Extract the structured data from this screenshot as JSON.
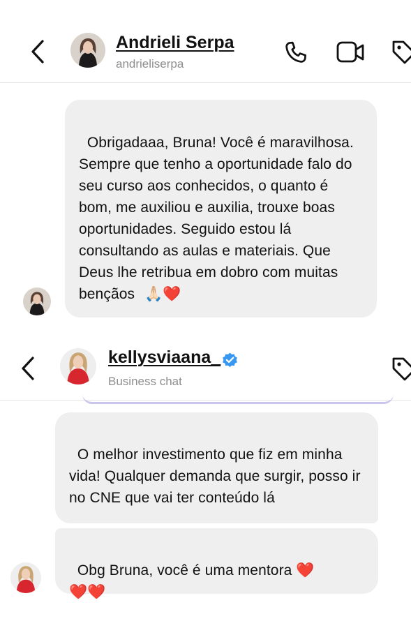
{
  "chat1": {
    "contact_name": "Andrieli Serpa",
    "username": "andrieliserpa",
    "message": "Obrigadaaa, Bruna! Você é maravilhosa. Sempre que tenho a oportunidade falo do seu curso aos conhecidos, o quanto é bom, me auxiliou e auxilia, trouxe boas oportunidades. Seguido estou lá consultando as aulas e materiais. Que Deus lhe retribua em dobro com muitas bençãos",
    "emoji": "🙏🏻❤️"
  },
  "chat2": {
    "contact_name": "kellysviaana_",
    "subtitle": "Business chat",
    "message1": "O melhor investimento que fiz em minha vida! Qualquer demanda que surgir, posso ir no CNE que vai ter conteúdo lá",
    "message2": "Obg Bruna, você é uma mentora",
    "emoji2_inline": "❤️",
    "emoji2_line": "❤️❤️"
  },
  "icons": [
    "back-arrow-icon",
    "phone-icon",
    "video-icon",
    "tag-icon",
    "verified-badge-icon"
  ],
  "colors": {
    "bubble": "#efefef",
    "verified": "#3897f0",
    "heart": "#e0182d",
    "subtle_text": "#8e8e8e"
  }
}
